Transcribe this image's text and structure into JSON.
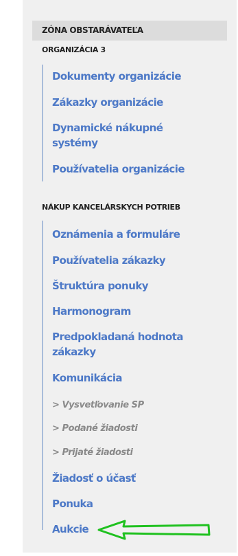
{
  "zone_header": "ZÓNA OBSTARÁVATEĽA",
  "sections": [
    {
      "title": "ORGANIZÁCIA 3",
      "items": [
        "Dokumenty organizácie",
        "Zákazky organizácie",
        "Dynamické nákupné",
        "systémy",
        "Používatelia organizácie"
      ]
    },
    {
      "title": "NÁKUP KANCELÁRSKYCH POTRIEB",
      "items": [
        "Oznámenia a formuláre",
        "Používatelia zákazky",
        "Štruktúra ponuky",
        "Harmonogram",
        "Predpokladaná hodnota",
        "zákazky",
        "Komunikácia"
      ],
      "subitems": [
        "> Vysvetľovanie SP",
        "> Podané žiadosti",
        "> Prijaté žiadosti"
      ],
      "items_after": [
        "Žiadosť o účasť",
        "Ponuka",
        "Aukcie"
      ]
    }
  ],
  "colors": {
    "link": "#4d79c7",
    "sublink": "#8a8a8a",
    "annotation_arrow": "#1fc11f"
  },
  "annotation": {
    "icon": "left-arrow-icon"
  }
}
